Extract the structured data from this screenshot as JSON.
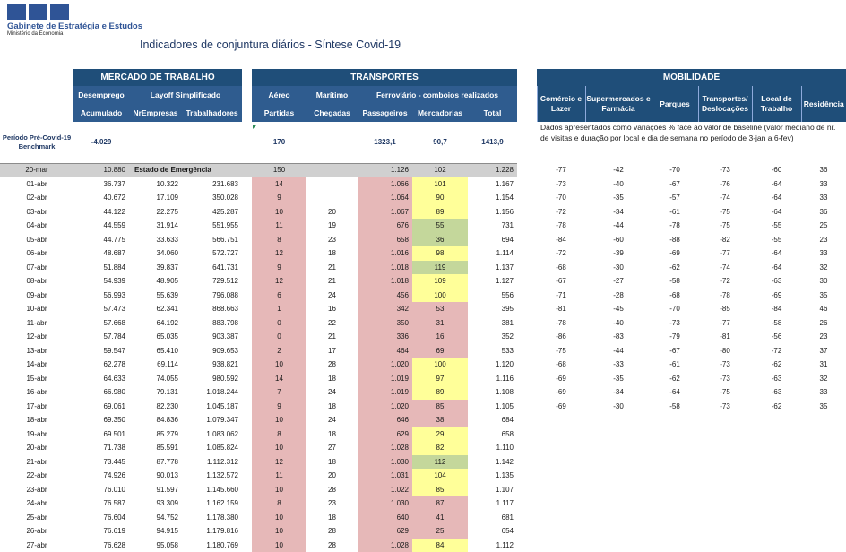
{
  "header": {
    "org_name": "Gabinete de Estratégia e Estudos",
    "ministry": "Ministério da Economia",
    "title": "Indicadores de conjuntura diários - Síntese Covid-19"
  },
  "sections": {
    "labor": "MERCADO DE TRABALHO",
    "transport": "TRANSPORTES",
    "mobility": "MOBILIDADE"
  },
  "subheaders": {
    "desemprego": "Desemprego",
    "layoff": "Layoff Simplificado",
    "aereo": "Aéreo",
    "maritimo": "Marítimo",
    "ferroviario": "Ferroviário - comboios realizados",
    "acumulado": "Acumulado",
    "nr_empresas": "NrEmpresas",
    "trabalhadores": "Trabalhadores",
    "partidas": "Partidas",
    "chegadas": "Chegadas",
    "passageiros": "Passageiros",
    "mercadorias": "Mercadorias",
    "total": "Total",
    "comercio_lazer": "Comércio e Lazer",
    "supermercados": "Supermercados e Farmácia",
    "parques": "Parques",
    "transportes_desl": "Transportes/ Deslocações",
    "local_trabalho": "Local de Trabalho",
    "residencia": "Residência"
  },
  "benchmark": {
    "label": "Período Pré-Covid-19 Benchmark",
    "desemprego": "-4.029",
    "aereo": "170",
    "passageiros": "1323,1",
    "mercadorias": "90,7",
    "total": "1413,9",
    "mobility_note": "Dados apresentados como variações % face ao valor de baseline (valor mediano de nr. de visitas e duração por local e dia de semana no período de 3-jan a 6-fev)"
  },
  "emergency_label": "Estado de Emergência",
  "rows": [
    {
      "date": "20-mar",
      "acumulado": "10.880",
      "nr_empresas": "",
      "trabalhadores": "",
      "aereo": "150",
      "maritimo": "",
      "passageiros": "1.126",
      "mercadorias": "102",
      "total": "1.228",
      "comercio": "-77",
      "super": "-42",
      "parques": "-70",
      "transp": "-73",
      "trabalho": "-60",
      "residencia": "36",
      "merc_color": "none",
      "emergency": true
    },
    {
      "date": "01-abr",
      "acumulado": "36.737",
      "nr_empresas": "10.322",
      "trabalhadores": "231.683",
      "aereo": "14",
      "maritimo": "",
      "passageiros": "1.066",
      "mercadorias": "101",
      "total": "1.167",
      "comercio": "-73",
      "super": "-40",
      "parques": "-67",
      "transp": "-76",
      "trabalho": "-64",
      "residencia": "33",
      "merc_color": "yellow"
    },
    {
      "date": "02-abr",
      "acumulado": "40.672",
      "nr_empresas": "17.109",
      "trabalhadores": "350.028",
      "aereo": "9",
      "maritimo": "",
      "passageiros": "1.064",
      "mercadorias": "90",
      "total": "1.154",
      "comercio": "-70",
      "super": "-35",
      "parques": "-57",
      "transp": "-74",
      "trabalho": "-64",
      "residencia": "33",
      "merc_color": "yellow"
    },
    {
      "date": "03-abr",
      "acumulado": "44.122",
      "nr_empresas": "22.275",
      "trabalhadores": "425.287",
      "aereo": "10",
      "maritimo": "20",
      "passageiros": "1.067",
      "mercadorias": "89",
      "total": "1.156",
      "comercio": "-72",
      "super": "-34",
      "parques": "-61",
      "transp": "-75",
      "trabalho": "-64",
      "residencia": "36",
      "merc_color": "yellow"
    },
    {
      "date": "04-abr",
      "acumulado": "44.559",
      "nr_empresas": "31.914",
      "trabalhadores": "551.955",
      "aereo": "11",
      "maritimo": "19",
      "passageiros": "676",
      "mercadorias": "55",
      "total": "731",
      "comercio": "-78",
      "super": "-44",
      "parques": "-78",
      "transp": "-75",
      "trabalho": "-55",
      "residencia": "25",
      "merc_color": "green"
    },
    {
      "date": "05-abr",
      "acumulado": "44.775",
      "nr_empresas": "33.633",
      "trabalhadores": "566.751",
      "aereo": "8",
      "maritimo": "23",
      "passageiros": "658",
      "mercadorias": "36",
      "total": "694",
      "comercio": "-84",
      "super": "-60",
      "parques": "-88",
      "transp": "-82",
      "trabalho": "-55",
      "residencia": "23",
      "merc_color": "green"
    },
    {
      "date": "06-abr",
      "acumulado": "48.687",
      "nr_empresas": "34.060",
      "trabalhadores": "572.727",
      "aereo": "12",
      "maritimo": "18",
      "passageiros": "1.016",
      "mercadorias": "98",
      "total": "1.114",
      "comercio": "-72",
      "super": "-39",
      "parques": "-69",
      "transp": "-77",
      "trabalho": "-64",
      "residencia": "33",
      "merc_color": "yellow"
    },
    {
      "date": "07-abr",
      "acumulado": "51.884",
      "nr_empresas": "39.837",
      "trabalhadores": "641.731",
      "aereo": "9",
      "maritimo": "21",
      "passageiros": "1.018",
      "mercadorias": "119",
      "total": "1.137",
      "comercio": "-68",
      "super": "-30",
      "parques": "-62",
      "transp": "-74",
      "trabalho": "-64",
      "residencia": "32",
      "merc_color": "green"
    },
    {
      "date": "08-abr",
      "acumulado": "54.939",
      "nr_empresas": "48.905",
      "trabalhadores": "729.512",
      "aereo": "12",
      "maritimo": "21",
      "passageiros": "1.018",
      "mercadorias": "109",
      "total": "1.127",
      "comercio": "-67",
      "super": "-27",
      "parques": "-58",
      "transp": "-72",
      "trabalho": "-63",
      "residencia": "30",
      "merc_color": "yellow"
    },
    {
      "date": "09-abr",
      "acumulado": "56.993",
      "nr_empresas": "55.639",
      "trabalhadores": "796.088",
      "aereo": "6",
      "maritimo": "24",
      "passageiros": "456",
      "mercadorias": "100",
      "total": "556",
      "comercio": "-71",
      "super": "-28",
      "parques": "-68",
      "transp": "-78",
      "trabalho": "-69",
      "residencia": "35",
      "merc_color": "yellow"
    },
    {
      "date": "10-abr",
      "acumulado": "57.473",
      "nr_empresas": "62.341",
      "trabalhadores": "868.663",
      "aereo": "1",
      "maritimo": "16",
      "passageiros": "342",
      "mercadorias": "53",
      "total": "395",
      "comercio": "-81",
      "super": "-45",
      "parques": "-70",
      "transp": "-85",
      "trabalho": "-84",
      "residencia": "46",
      "merc_color": "pink"
    },
    {
      "date": "11-abr",
      "acumulado": "57.668",
      "nr_empresas": "64.192",
      "trabalhadores": "883.798",
      "aereo": "0",
      "maritimo": "22",
      "passageiros": "350",
      "mercadorias": "31",
      "total": "381",
      "comercio": "-78",
      "super": "-40",
      "parques": "-73",
      "transp": "-77",
      "trabalho": "-58",
      "residencia": "26",
      "merc_color": "pink"
    },
    {
      "date": "12-abr",
      "acumulado": "57.784",
      "nr_empresas": "65.035",
      "trabalhadores": "903.387",
      "aereo": "0",
      "maritimo": "21",
      "passageiros": "336",
      "mercadorias": "16",
      "total": "352",
      "comercio": "-86",
      "super": "-83",
      "parques": "-79",
      "transp": "-81",
      "trabalho": "-56",
      "residencia": "23",
      "merc_color": "pink"
    },
    {
      "date": "13-abr",
      "acumulado": "59.547",
      "nr_empresas": "65.410",
      "trabalhadores": "909.653",
      "aereo": "2",
      "maritimo": "17",
      "passageiros": "464",
      "mercadorias": "69",
      "total": "533",
      "comercio": "-75",
      "super": "-44",
      "parques": "-67",
      "transp": "-80",
      "trabalho": "-72",
      "residencia": "37",
      "merc_color": "pink"
    },
    {
      "date": "14-abr",
      "acumulado": "62.278",
      "nr_empresas": "69.114",
      "trabalhadores": "938.821",
      "aereo": "10",
      "maritimo": "28",
      "passageiros": "1.020",
      "mercadorias": "100",
      "total": "1.120",
      "comercio": "-68",
      "super": "-33",
      "parques": "-61",
      "transp": "-73",
      "trabalho": "-62",
      "residencia": "31",
      "merc_color": "yellow"
    },
    {
      "date": "15-abr",
      "acumulado": "64.633",
      "nr_empresas": "74.055",
      "trabalhadores": "980.592",
      "aereo": "14",
      "maritimo": "18",
      "passageiros": "1.019",
      "mercadorias": "97",
      "total": "1.116",
      "comercio": "-69",
      "super": "-35",
      "parques": "-62",
      "transp": "-73",
      "trabalho": "-63",
      "residencia": "32",
      "merc_color": "yellow"
    },
    {
      "date": "16-abr",
      "acumulado": "66.980",
      "nr_empresas": "79.131",
      "trabalhadores": "1.018.244",
      "aereo": "7",
      "maritimo": "24",
      "passageiros": "1.019",
      "mercadorias": "89",
      "total": "1.108",
      "comercio": "-69",
      "super": "-34",
      "parques": "-64",
      "transp": "-75",
      "trabalho": "-63",
      "residencia": "33",
      "merc_color": "yellow"
    },
    {
      "date": "17-abr",
      "acumulado": "69.061",
      "nr_empresas": "82.230",
      "trabalhadores": "1.045.187",
      "aereo": "9",
      "maritimo": "18",
      "passageiros": "1.020",
      "mercadorias": "85",
      "total": "1.105",
      "comercio": "-69",
      "super": "-30",
      "parques": "-58",
      "transp": "-73",
      "trabalho": "-62",
      "residencia": "35",
      "merc_color": "pink"
    },
    {
      "date": "18-abr",
      "acumulado": "69.350",
      "nr_empresas": "84.836",
      "trabalhadores": "1.079.347",
      "aereo": "10",
      "maritimo": "24",
      "passageiros": "646",
      "mercadorias": "38",
      "total": "684",
      "comercio": "",
      "super": "",
      "parques": "",
      "transp": "",
      "trabalho": "",
      "residencia": "",
      "merc_color": "pink"
    },
    {
      "date": "19-abr",
      "acumulado": "69.501",
      "nr_empresas": "85.279",
      "trabalhadores": "1.083.062",
      "aereo": "8",
      "maritimo": "18",
      "passageiros": "629",
      "mercadorias": "29",
      "total": "658",
      "comercio": "",
      "super": "",
      "parques": "",
      "transp": "",
      "trabalho": "",
      "residencia": "",
      "merc_color": "yellow"
    },
    {
      "date": "20-abr",
      "acumulado": "71.738",
      "nr_empresas": "85.591",
      "trabalhadores": "1.085.824",
      "aereo": "10",
      "maritimo": "27",
      "passageiros": "1.028",
      "mercadorias": "82",
      "total": "1.110",
      "comercio": "",
      "super": "",
      "parques": "",
      "transp": "",
      "trabalho": "",
      "residencia": "",
      "merc_color": "yellow"
    },
    {
      "date": "21-abr",
      "acumulado": "73.445",
      "nr_empresas": "87.778",
      "trabalhadores": "1.112.312",
      "aereo": "12",
      "maritimo": "18",
      "passageiros": "1.030",
      "mercadorias": "112",
      "total": "1.142",
      "comercio": "",
      "super": "",
      "parques": "",
      "transp": "",
      "trabalho": "",
      "residencia": "",
      "merc_color": "green"
    },
    {
      "date": "22-abr",
      "acumulado": "74.926",
      "nr_empresas": "90.013",
      "trabalhadores": "1.132.572",
      "aereo": "11",
      "maritimo": "20",
      "passageiros": "1.031",
      "mercadorias": "104",
      "total": "1.135",
      "comercio": "",
      "super": "",
      "parques": "",
      "transp": "",
      "trabalho": "",
      "residencia": "",
      "merc_color": "yellow"
    },
    {
      "date": "23-abr",
      "acumulado": "76.010",
      "nr_empresas": "91.597",
      "trabalhadores": "1.145.660",
      "aereo": "10",
      "maritimo": "28",
      "passageiros": "1.022",
      "mercadorias": "85",
      "total": "1.107",
      "comercio": "",
      "super": "",
      "parques": "",
      "transp": "",
      "trabalho": "",
      "residencia": "",
      "merc_color": "yellow"
    },
    {
      "date": "24-abr",
      "acumulado": "76.587",
      "nr_empresas": "93.309",
      "trabalhadores": "1.162.159",
      "aereo": "8",
      "maritimo": "23",
      "passageiros": "1.030",
      "mercadorias": "87",
      "total": "1.117",
      "comercio": "",
      "super": "",
      "parques": "",
      "transp": "",
      "trabalho": "",
      "residencia": "",
      "merc_color": "pink"
    },
    {
      "date": "25-abr",
      "acumulado": "76.604",
      "nr_empresas": "94.752",
      "trabalhadores": "1.178.380",
      "aereo": "10",
      "maritimo": "18",
      "passageiros": "640",
      "mercadorias": "41",
      "total": "681",
      "comercio": "",
      "super": "",
      "parques": "",
      "transp": "",
      "trabalho": "",
      "residencia": "",
      "merc_color": "pink"
    },
    {
      "date": "26-abr",
      "acumulado": "76.619",
      "nr_empresas": "94.915",
      "trabalhadores": "1.179.816",
      "aereo": "10",
      "maritimo": "28",
      "passageiros": "629",
      "mercadorias": "25",
      "total": "654",
      "comercio": "",
      "super": "",
      "parques": "",
      "transp": "",
      "trabalho": "",
      "residencia": "",
      "merc_color": "pink"
    },
    {
      "date": "27-abr",
      "acumulado": "76.628",
      "nr_empresas": "95.058",
      "trabalhadores": "1.180.769",
      "aereo": "10",
      "maritimo": "28",
      "passageiros": "1.028",
      "mercadorias": "84",
      "total": "1.112",
      "comercio": "",
      "super": "",
      "parques": "",
      "transp": "",
      "trabalho": "",
      "residencia": "",
      "merc_color": "yellow"
    }
  ]
}
